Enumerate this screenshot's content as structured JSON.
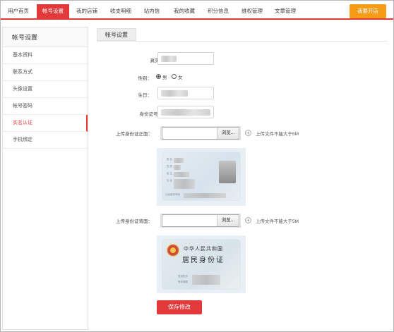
{
  "nav": {
    "tabs": [
      "用户首页",
      "帐号设置",
      "我的店铺",
      "收支明细",
      "站内信",
      "我的收藏",
      "积分信息",
      "维权管理",
      "文章管理"
    ],
    "active_index": 1,
    "open_shop_label": "我要开店"
  },
  "sidebar": {
    "title": "帐号设置",
    "items": [
      "基本资料",
      "联系方式",
      "头像设置",
      "帐号密码",
      "实名认证",
      "手机绑定"
    ],
    "active_index": 4
  },
  "main": {
    "tab_label": "帐号设置",
    "fields": {
      "real_name_label": "真实名称：",
      "gender_label": "性别：",
      "gender_male": "男",
      "gender_female": "女",
      "gender_selected": "男",
      "birthday_label": "生日：",
      "id_number_label": "身份证号：",
      "upload_front_label": "上传身份证正面：",
      "upload_back_label": "上传身份证背面：",
      "browse_label": "浏览...",
      "upload_hint": "上传文件不能大于5M"
    },
    "id_back_text": {
      "line1": "中华人民共和国",
      "line2": "居民身份证"
    },
    "save_label": "保存修改"
  },
  "colors": {
    "accent": "#e23a3a",
    "shop_button": "#f59b16"
  }
}
